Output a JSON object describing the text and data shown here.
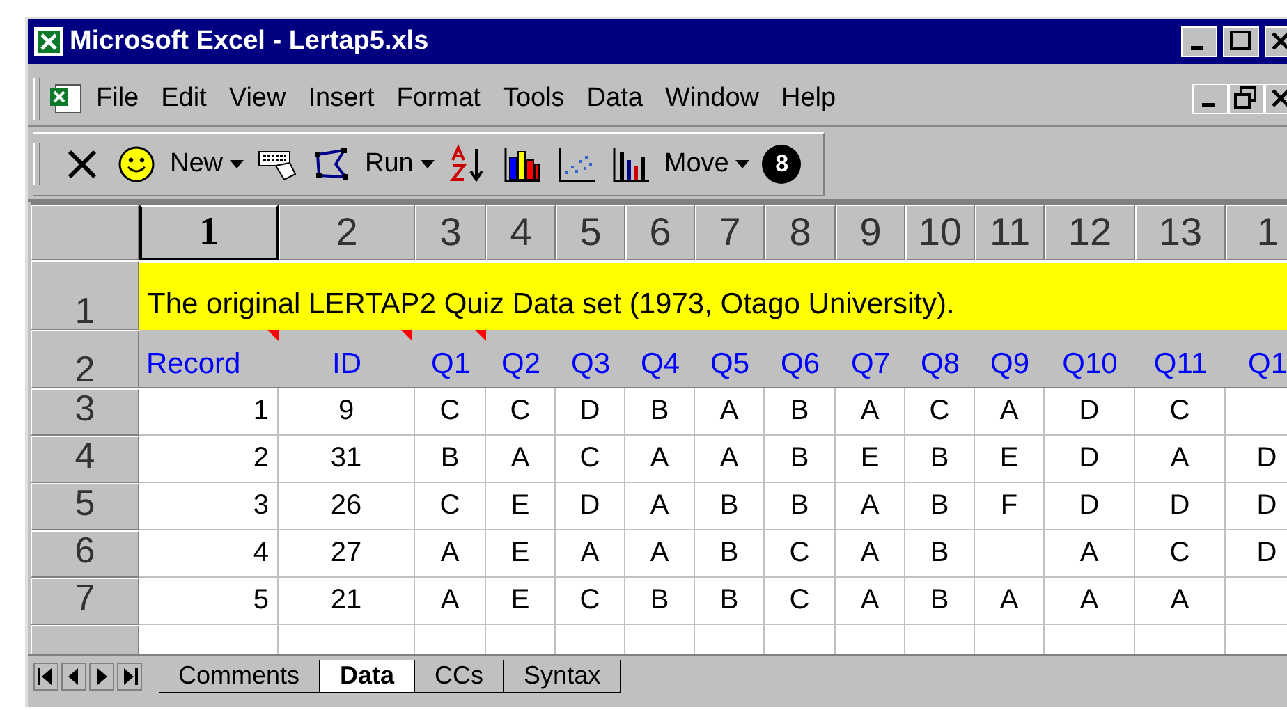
{
  "window": {
    "title": "Microsoft Excel - Lertap5.xls"
  },
  "menu": [
    "File",
    "Edit",
    "View",
    "Insert",
    "Format",
    "Tools",
    "Data",
    "Window",
    "Help"
  ],
  "toolbar": [
    {
      "kind": "close"
    },
    {
      "kind": "smiley"
    },
    {
      "kind": "dropdown",
      "label": "New"
    },
    {
      "kind": "keyboard"
    },
    {
      "kind": "polygon"
    },
    {
      "kind": "dropdown",
      "label": "Run"
    },
    {
      "kind": "sort"
    },
    {
      "kind": "barchart"
    },
    {
      "kind": "scatter"
    },
    {
      "kind": "histogram"
    },
    {
      "kind": "dropdown",
      "label": "Move"
    },
    {
      "kind": "eightball",
      "label": "8"
    }
  ],
  "grid": {
    "column_headers": [
      {
        "label": "1",
        "selected": true
      },
      {
        "label": "2",
        "selected": false
      },
      {
        "label": "3",
        "selected": false
      },
      {
        "label": "4",
        "selected": false
      },
      {
        "label": "5",
        "selected": false
      },
      {
        "label": "6",
        "selected": false
      },
      {
        "label": "7",
        "selected": false
      },
      {
        "label": "8",
        "selected": false
      },
      {
        "label": "9",
        "selected": false
      },
      {
        "label": "10",
        "selected": false
      },
      {
        "label": "11",
        "selected": false
      },
      {
        "label": "12",
        "selected": false
      },
      {
        "label": "13",
        "selected": false
      },
      {
        "label": "1",
        "selected": false
      }
    ],
    "rows": [
      {
        "header": "1",
        "kind": "title",
        "text": "The original LERTAP2 Quiz Data set (1973, Otago University)."
      },
      {
        "header": "2",
        "kind": "fields",
        "cells": [
          {
            "text": "Record",
            "comment": true
          },
          {
            "text": "ID",
            "comment": true
          },
          {
            "text": "Q1",
            "comment": true
          },
          {
            "text": "Q2",
            "comment": false
          },
          {
            "text": "Q3",
            "comment": false
          },
          {
            "text": "Q4",
            "comment": false
          },
          {
            "text": "Q5",
            "comment": false
          },
          {
            "text": "Q6",
            "comment": false
          },
          {
            "text": "Q7",
            "comment": false
          },
          {
            "text": "Q8",
            "comment": false
          },
          {
            "text": "Q9",
            "comment": false
          },
          {
            "text": "Q10",
            "comment": false
          },
          {
            "text": "Q11",
            "comment": false
          },
          {
            "text": "Q1",
            "comment": false
          }
        ]
      },
      {
        "header": "3",
        "kind": "data",
        "cells": [
          "1",
          "9",
          "C",
          "C",
          "D",
          "B",
          "A",
          "B",
          "A",
          "C",
          "A",
          "D",
          "C",
          null
        ]
      },
      {
        "header": "4",
        "kind": "data",
        "cells": [
          "2",
          "31",
          "B",
          "A",
          "C",
          "A",
          "A",
          "B",
          "E",
          "B",
          "E",
          "D",
          "A",
          "D"
        ]
      },
      {
        "header": "5",
        "kind": "data",
        "cells": [
          "3",
          "26",
          "C",
          "E",
          "D",
          "A",
          "B",
          "B",
          "A",
          "B",
          "F",
          "D",
          "D",
          "D"
        ]
      },
      {
        "header": "6",
        "kind": "data",
        "cells": [
          "4",
          "27",
          "A",
          "E",
          "A",
          "A",
          "B",
          "C",
          "A",
          "B",
          null,
          "A",
          "C",
          "D"
        ]
      },
      {
        "header": "7",
        "kind": "data",
        "cells": [
          "5",
          "21",
          "A",
          "E",
          "C",
          "B",
          "B",
          "C",
          "A",
          "B",
          "A",
          "A",
          "A",
          null
        ]
      }
    ]
  },
  "sheet_tabs": [
    {
      "label": "Comments",
      "selected": false
    },
    {
      "label": "Data",
      "selected": true
    },
    {
      "label": "CCs",
      "selected": false
    },
    {
      "label": "Syntax",
      "selected": false
    }
  ]
}
